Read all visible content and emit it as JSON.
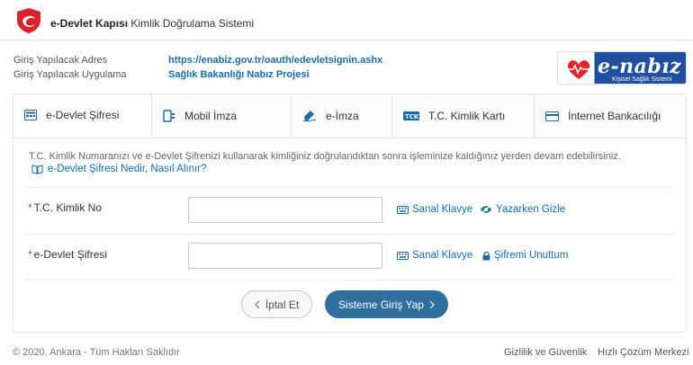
{
  "header": {
    "title_bold": "e-Devlet Kapısı",
    "title_rest": " Kimlik Doğrulama Sistemi"
  },
  "app_info": {
    "address_label": "Giriş Yapılacak Adres",
    "app_label": "Giriş Yapılacak Uygulama",
    "address_value": "https://enabiz.gov.tr/oauth/edevletsignin.ashx",
    "app_value": "Sağlık Bakanlığı Nabız Projesi"
  },
  "brand": {
    "logo_text": "e-nabız",
    "logo_sub": "Kişisel Sağlık Sistemi"
  },
  "tabs": [
    {
      "label": "e-Devlet Şifresi",
      "icon": "card-grid-icon"
    },
    {
      "label": "Mobil İmza",
      "icon": "mobile-signature-icon"
    },
    {
      "label": "e-İmza",
      "icon": "pen-signature-icon"
    },
    {
      "label": "T.C. Kimlik Kartı",
      "icon": "id-card-icon"
    },
    {
      "label": "İnternet Bankacılığı",
      "icon": "bank-card-icon"
    }
  ],
  "description": "T.C. Kimlik Numaranızı ve e-Devlet Şifrenizi kullanarak kimliğiniz doğrulandıktan sonra işleminize kaldığınız yerden devam edebilirsiniz.",
  "help_link": "e-Devlet Şifresi Nedir, Nasıl Alınır?",
  "form": {
    "tc_label": "T.C. Kimlik No",
    "tc_value": "",
    "password_label": "e-Devlet Şifresi",
    "password_value": "",
    "virtual_keyboard": "Sanal Klavye",
    "hide_typing": "Yazarken Gizle",
    "forgot_password": "Şifremi Unuttum",
    "required_mark": "*"
  },
  "buttons": {
    "cancel": "İptal Et",
    "login": "Sisteme Giriş Yap"
  },
  "footer": {
    "copyright": "© 2020, Ankara - Tüm Hakları Saklıdır",
    "privacy": "Gizlilik ve Güvenlik",
    "support": "Hızlı Çözüm Merkezi"
  },
  "colors": {
    "accent": "#2e6f9e",
    "link": "#1c6ba8",
    "logo_red": "#d8232a",
    "brand_blue": "#1f4f9e"
  }
}
